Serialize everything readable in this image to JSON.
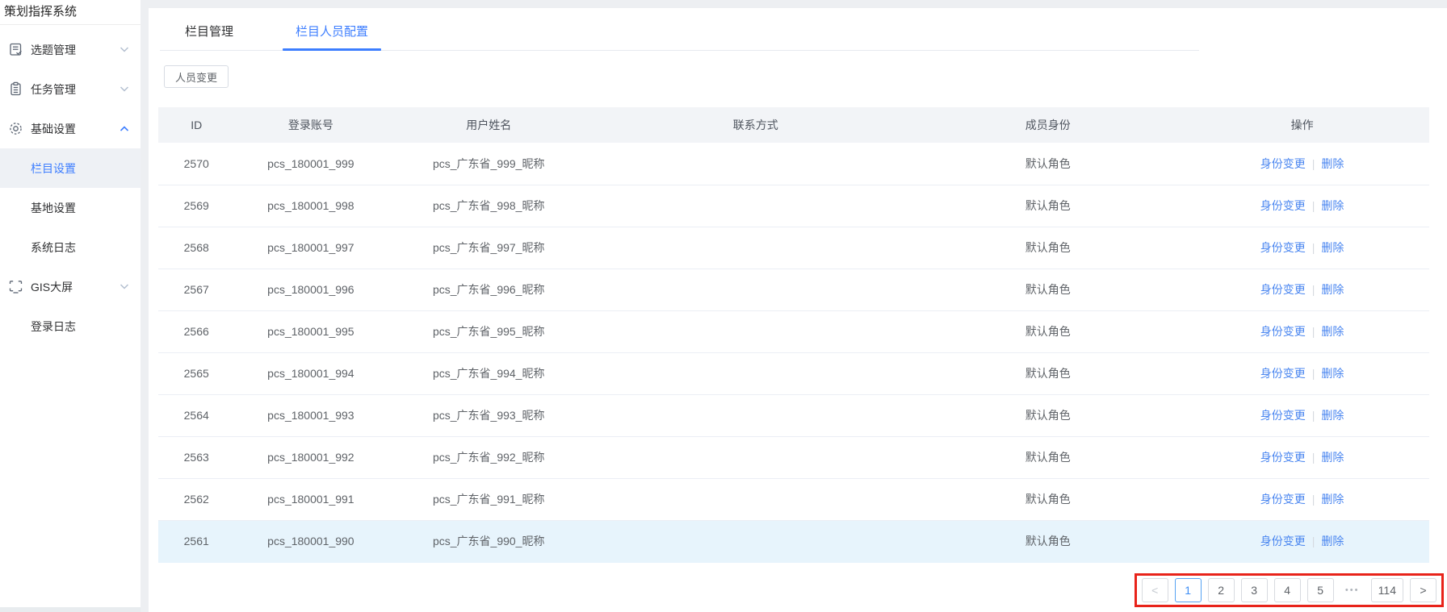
{
  "app": {
    "title": "策划指挥系统"
  },
  "sidebar": {
    "items": [
      {
        "label": "选题管理",
        "icon": "topic-doc-icon",
        "chevron": "down"
      },
      {
        "label": "任务管理",
        "icon": "task-clipboard-icon",
        "chevron": "down"
      },
      {
        "label": "基础设置",
        "icon": "gear-icon",
        "chevron": "up",
        "expanded": true,
        "children": [
          {
            "label": "栏目设置",
            "selected": true
          },
          {
            "label": "基地设置",
            "selected": false
          },
          {
            "label": "系统日志",
            "selected": false
          }
        ]
      },
      {
        "label": "GIS大屏",
        "icon": "screen-icon",
        "chevron": "down"
      },
      {
        "label": "登录日志",
        "icon": null,
        "chevron": null
      }
    ]
  },
  "tabs": [
    {
      "label": "栏目管理",
      "active": false
    },
    {
      "label": "栏目人员配置",
      "active": true
    }
  ],
  "toolbar": {
    "change_button": "人员变更"
  },
  "table": {
    "columns": [
      "ID",
      "登录账号",
      "用户姓名",
      "联系方式",
      "成员身份",
      "操作"
    ],
    "actions": {
      "change": "身份变更",
      "divider": "|",
      "delete": "删除"
    },
    "rows": [
      {
        "id": "2570",
        "account": "pcs_180001_999",
        "name": "pcs_广东省_999_昵称",
        "contact": "",
        "role": "默认角色",
        "highlighted": false
      },
      {
        "id": "2569",
        "account": "pcs_180001_998",
        "name": "pcs_广东省_998_昵称",
        "contact": "",
        "role": "默认角色",
        "highlighted": false
      },
      {
        "id": "2568",
        "account": "pcs_180001_997",
        "name": "pcs_广东省_997_昵称",
        "contact": "",
        "role": "默认角色",
        "highlighted": false
      },
      {
        "id": "2567",
        "account": "pcs_180001_996",
        "name": "pcs_广东省_996_昵称",
        "contact": "",
        "role": "默认角色",
        "highlighted": false
      },
      {
        "id": "2566",
        "account": "pcs_180001_995",
        "name": "pcs_广东省_995_昵称",
        "contact": "",
        "role": "默认角色",
        "highlighted": false
      },
      {
        "id": "2565",
        "account": "pcs_180001_994",
        "name": "pcs_广东省_994_昵称",
        "contact": "",
        "role": "默认角色",
        "highlighted": false
      },
      {
        "id": "2564",
        "account": "pcs_180001_993",
        "name": "pcs_广东省_993_昵称",
        "contact": "",
        "role": "默认角色",
        "highlighted": false
      },
      {
        "id": "2563",
        "account": "pcs_180001_992",
        "name": "pcs_广东省_992_昵称",
        "contact": "",
        "role": "默认角色",
        "highlighted": false
      },
      {
        "id": "2562",
        "account": "pcs_180001_991",
        "name": "pcs_广东省_991_昵称",
        "contact": "",
        "role": "默认角色",
        "highlighted": false
      },
      {
        "id": "2561",
        "account": "pcs_180001_990",
        "name": "pcs_广东省_990_昵称",
        "contact": "",
        "role": "默认角色",
        "highlighted": true
      }
    ]
  },
  "pagination": {
    "prev": "<",
    "pages": [
      "1",
      "2",
      "3",
      "4",
      "5"
    ],
    "active": "1",
    "ellipsis": "•••",
    "last": "114",
    "next": ">"
  },
  "colors": {
    "primary": "#3d7eff",
    "link": "#4a86f0",
    "highlight_row": "#e7f4fc",
    "annotation": "#e8231a"
  }
}
